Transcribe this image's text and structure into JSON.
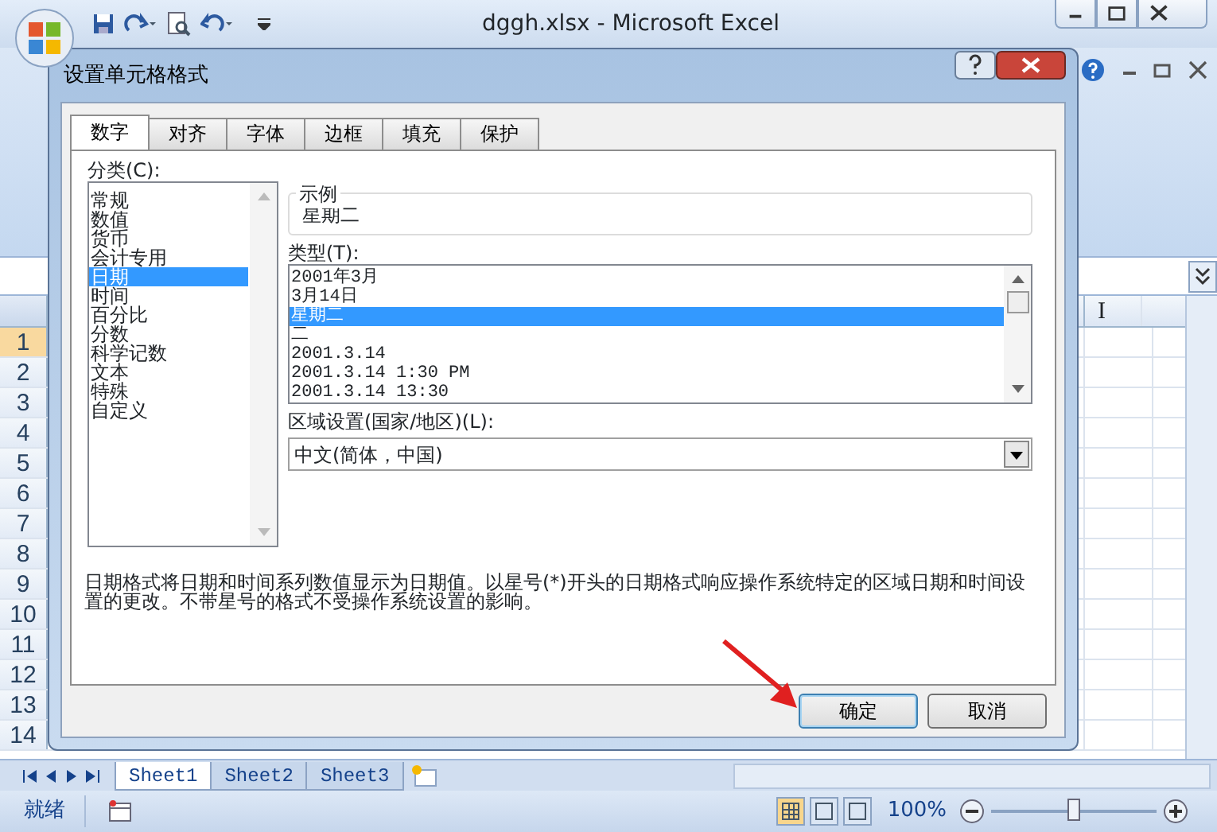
{
  "window": {
    "title": "dggh.xlsx - Microsoft Excel"
  },
  "sheet": {
    "column_headers": [
      "I"
    ],
    "rows": [
      {
        "label": "1",
        "selected": true
      },
      {
        "label": "2",
        "selected": false
      },
      {
        "label": "3",
        "selected": false
      },
      {
        "label": "4",
        "selected": false
      },
      {
        "label": "5",
        "selected": false
      },
      {
        "label": "6",
        "selected": false
      },
      {
        "label": "7",
        "selected": false
      },
      {
        "label": "8",
        "selected": false
      },
      {
        "label": "9",
        "selected": false
      },
      {
        "label": "10",
        "selected": false
      },
      {
        "label": "11",
        "selected": false
      },
      {
        "label": "12",
        "selected": false
      },
      {
        "label": "13",
        "selected": false
      },
      {
        "label": "14",
        "selected": false
      }
    ]
  },
  "dialog": {
    "title": "设置单元格格式",
    "tabs": [
      {
        "label": "数字",
        "selected": true
      },
      {
        "label": "对齐",
        "selected": false
      },
      {
        "label": "字体",
        "selected": false
      },
      {
        "label": "边框",
        "selected": false
      },
      {
        "label": "填充",
        "selected": false
      },
      {
        "label": "保护",
        "selected": false
      }
    ],
    "category_label": "分类(C):",
    "categories": [
      {
        "label": "常规",
        "selected": false
      },
      {
        "label": "数值",
        "selected": false
      },
      {
        "label": "货币",
        "selected": false
      },
      {
        "label": "会计专用",
        "selected": false
      },
      {
        "label": "日期",
        "selected": true
      },
      {
        "label": "时间",
        "selected": false
      },
      {
        "label": "百分比",
        "selected": false
      },
      {
        "label": "分数",
        "selected": false
      },
      {
        "label": "科学记数",
        "selected": false
      },
      {
        "label": "文本",
        "selected": false
      },
      {
        "label": "特殊",
        "selected": false
      },
      {
        "label": "自定义",
        "selected": false
      }
    ],
    "sample_label": "示例",
    "sample_value": "星期二",
    "type_label": "类型(T):",
    "types": [
      {
        "label": "2001年3月",
        "selected": false
      },
      {
        "label": "3月14日",
        "selected": false
      },
      {
        "label": "星期二",
        "selected": true
      },
      {
        "label": "二",
        "selected": false
      },
      {
        "label": "2001.3.14",
        "selected": false
      },
      {
        "label": "2001.3.14 1:30 PM",
        "selected": false
      },
      {
        "label": "2001.3.14 13:30",
        "selected": false
      }
    ],
    "locale_label": "区域设置(国家/地区)(L):",
    "locale_value": "中文(简体，中国)",
    "description": "日期格式将日期和时间系列数值显示为日期值。以星号(*)开头的日期格式响应操作系统特定的区域日期和时间设置的更改。不带星号的格式不受操作系统设置的影响。",
    "buttons": [
      {
        "label": "确定",
        "default": true
      },
      {
        "label": "取消",
        "default": false
      }
    ]
  },
  "sheet_tabs": [
    {
      "label": "Sheet1",
      "selected": true
    },
    {
      "label": "Sheet2",
      "selected": false
    },
    {
      "label": "Sheet3",
      "selected": false
    }
  ],
  "status_bar": {
    "status": "就绪",
    "zoom": "100%",
    "zoom_slider": {
      "level": 0.5
    }
  }
}
